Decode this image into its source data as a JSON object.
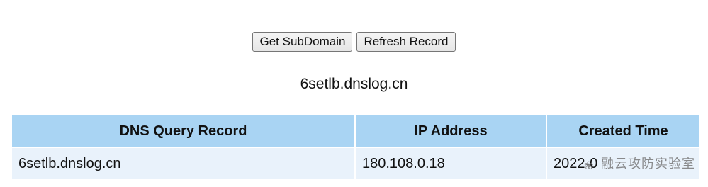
{
  "buttons": {
    "get_subdomain": "Get SubDomain",
    "refresh_record": "Refresh Record"
  },
  "subdomain": "6setlb.dnslog.cn",
  "table": {
    "headers": [
      "DNS Query Record",
      "IP Address",
      "Created Time"
    ],
    "rows": [
      [
        "6setlb.dnslog.cn",
        "180.108.0.18",
        "2022-0"
      ]
    ]
  },
  "watermark": {
    "text": "融云攻防实验室",
    "icon": "wechat-icon"
  },
  "colors": {
    "header_bg": "#a9d4f3",
    "row_bg": "#e9f2fb"
  }
}
